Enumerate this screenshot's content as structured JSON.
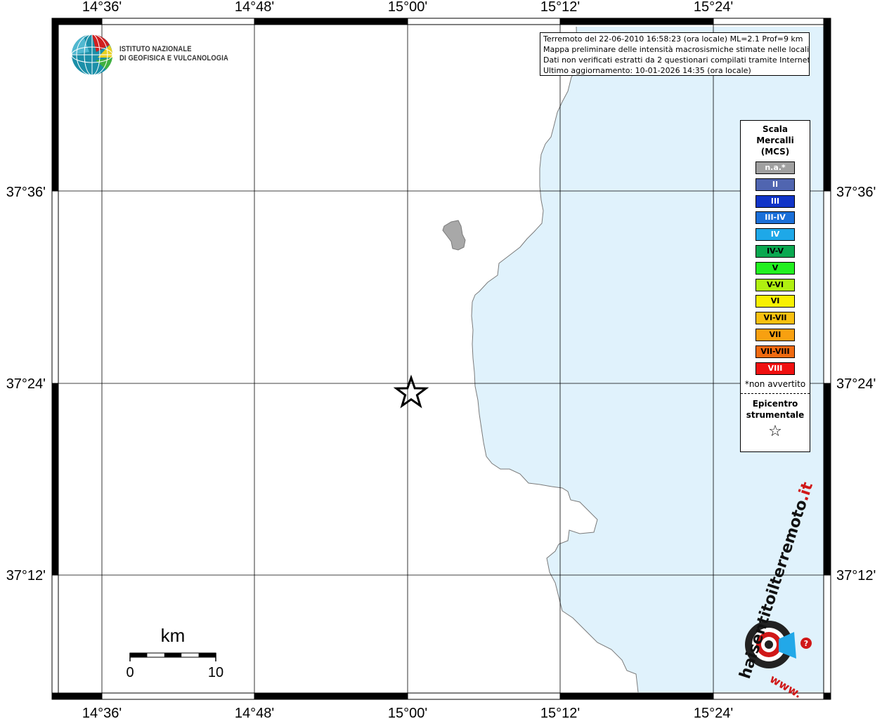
{
  "header": {
    "info_lines": [
      "Terremoto del 22-06-2010 16:58:23 (ora locale) ML=2.1 Prof=9 km",
      "Mappa preliminare delle intensità macrosismiche stimate nelle località",
      "Dati non verificati estratti da 2 questionari compilati tramite Internet.",
      "Ultimo aggiornamento: 10-01-2026 14:35 (ora locale)"
    ]
  },
  "logo": {
    "name_line1": "ISTITUTO NAZIONALE",
    "name_line2": "DI GEOFISICA E VULCANOLOGIA",
    "icon": "ingv-globe-icon"
  },
  "map": {
    "lon_ticks": [
      "14°36'",
      "14°48'",
      "15°00'",
      "15°12'",
      "15°24'"
    ],
    "lat_ticks": [
      "37°36'",
      "37°24'",
      "37°12'"
    ],
    "colors": {
      "sea": "#e0f2fc",
      "land": "#ffffff",
      "island": "#a8a8a8",
      "coast": "#7a7a7a"
    },
    "epicenter_icon": "star-icon"
  },
  "scale_bar": {
    "unit": "km",
    "min_label": "0",
    "max_label": "10"
  },
  "legend": {
    "title_line1": "Scala",
    "title_line2": "Mercalli",
    "title_line3": "(MCS)",
    "items": [
      {
        "label": "n.a.*",
        "color": "#a0a0a0",
        "text": "#ffffff"
      },
      {
        "label": "II",
        "color": "#5065b0",
        "text": "#ffffff"
      },
      {
        "label": "III",
        "color": "#1034c8",
        "text": "#ffffff"
      },
      {
        "label": "III-IV",
        "color": "#1a6fd8",
        "text": "#ffffff"
      },
      {
        "label": "IV",
        "color": "#1ea8e8",
        "text": "#ffffff"
      },
      {
        "label": "IV-V",
        "color": "#0aa850",
        "text": "#000000"
      },
      {
        "label": "V",
        "color": "#22f020",
        "text": "#000000"
      },
      {
        "label": "V-VI",
        "color": "#b0f010",
        "text": "#000000"
      },
      {
        "label": "VI",
        "color": "#f8f000",
        "text": "#000000"
      },
      {
        "label": "VI-VII",
        "color": "#f8c010",
        "text": "#000000"
      },
      {
        "label": "VII",
        "color": "#f8a010",
        "text": "#000000"
      },
      {
        "label": "VII-VIII",
        "color": "#f06a10",
        "text": "#000000"
      },
      {
        "label": "VIII",
        "color": "#f01010",
        "text": "#ffffff"
      }
    ],
    "note": "*non avvertito",
    "epicenter_line1": "Epicentro",
    "epicenter_line2": "strumentale",
    "epicenter_icon": "star-outline-icon"
  },
  "watermark": {
    "text_main": "haisentitoilterremoto",
    "text_tld": ".it",
    "text_www": "www.",
    "icon": "target-megaphone-icon"
  }
}
